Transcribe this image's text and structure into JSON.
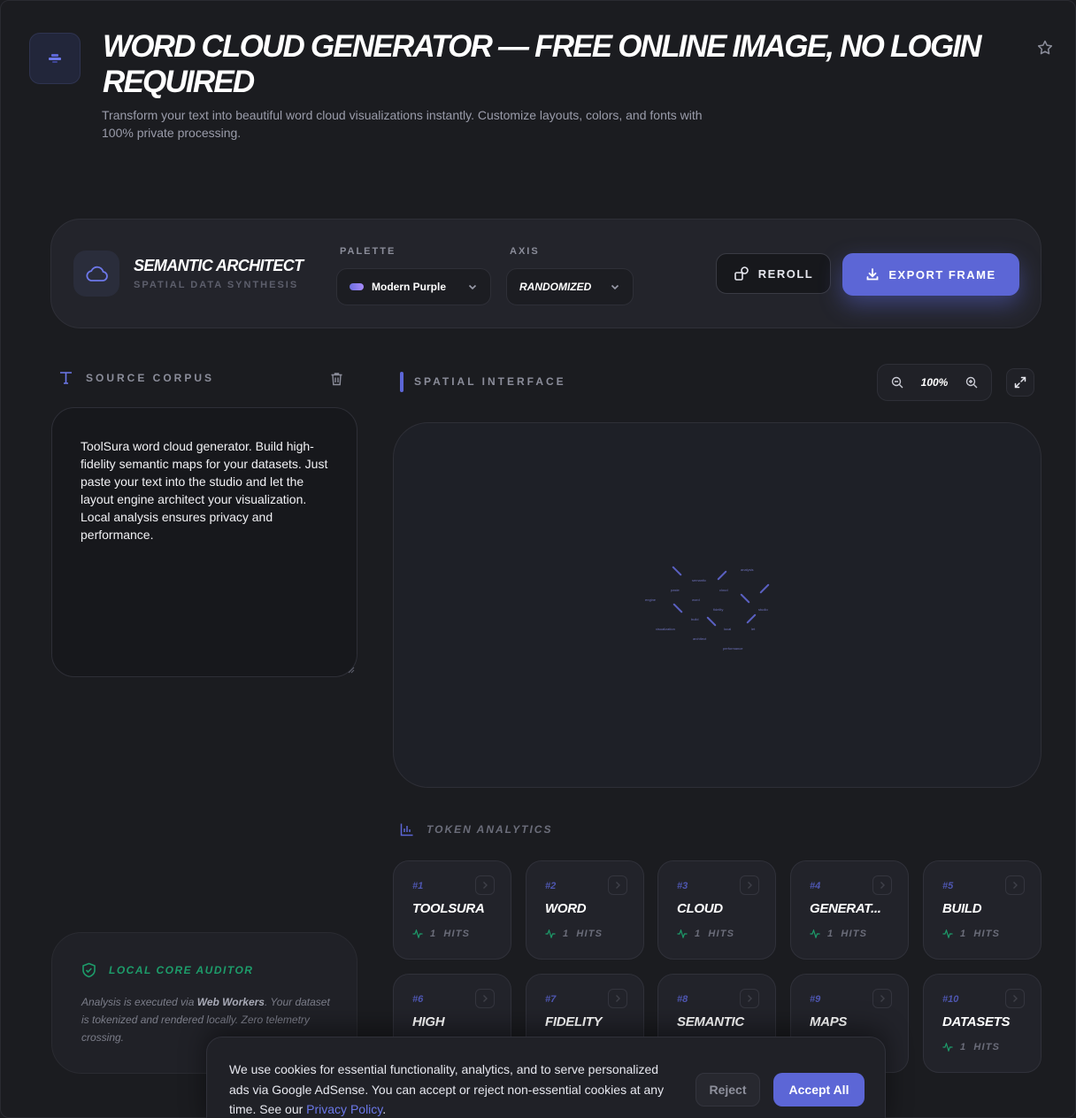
{
  "header": {
    "title": "WORD CLOUD GENERATOR — FREE ONLINE IMAGE, NO LOGIN REQUIRED",
    "subtitle": "Transform your text into beautiful word cloud visualizations instantly. Customize layouts, colors, and fonts with 100% private processing.",
    "logo_icon": "app-logo-icon",
    "favorite_icon": "star-icon"
  },
  "toolbar": {
    "brand_title": "SEMANTIC ARCHITECT",
    "brand_subtitle": "SPATIAL DATA SYNTHESIS",
    "brand_icon": "cloud-icon",
    "palette_label": "PALETTE",
    "palette_value": "Modern Purple",
    "axis_label": "AXIS",
    "axis_value": "RANDOMIZED",
    "reroll_label": "REROLL",
    "export_label": "EXPORT FRAME",
    "accent_color": "#5c66d6"
  },
  "source": {
    "label": "SOURCE CORPUS",
    "text": "ToolSura word cloud generator. Build high-fidelity semantic maps for your datasets. Just paste your text into the studio and let the layout engine architect your visualization. Local analysis ensures privacy and performance."
  },
  "auditor": {
    "title": "LOCAL CORE AUDITOR",
    "text_1": "Analysis is executed via ",
    "text_bold": "Web Workers",
    "text_2": ". Your dataset is tokenized and rendered locally. Zero telemetry crossing."
  },
  "spatial": {
    "label": "SPATIAL INTERFACE",
    "zoom": "100%",
    "cloud_words": [
      "semantic",
      "analysis",
      "paste",
      "cloud",
      "engine",
      "word",
      "fidelity",
      "studio",
      "build",
      "visualization",
      "local",
      "let",
      "architect",
      "performance"
    ]
  },
  "analytics": {
    "label": "TOKEN ANALYTICS",
    "hits_suffix": "HITS",
    "tokens": [
      {
        "rank": "#1",
        "word": "TOOLSURA",
        "hits": "1"
      },
      {
        "rank": "#2",
        "word": "WORD",
        "hits": "1"
      },
      {
        "rank": "#3",
        "word": "CLOUD",
        "hits": "1"
      },
      {
        "rank": "#4",
        "word": "GENERAT...",
        "hits": "1"
      },
      {
        "rank": "#5",
        "word": "BUILD",
        "hits": "1"
      },
      {
        "rank": "#6",
        "word": "HIGH",
        "hits": ""
      },
      {
        "rank": "#7",
        "word": "FIDELITY",
        "hits": ""
      },
      {
        "rank": "#8",
        "word": "SEMANTIC",
        "hits": ""
      },
      {
        "rank": "#9",
        "word": "MAPS",
        "hits": ""
      },
      {
        "rank": "#10",
        "word": "DATASETS",
        "hits": "1"
      }
    ]
  },
  "cookie": {
    "text": "We use cookies for essential functionality, analytics, and to serve personalized ads via Google AdSense. You can accept or reject non-essential cookies at any time. See our ",
    "link": "Privacy Policy",
    "end": ".",
    "reject_label": "Reject",
    "accept_label": "Accept All"
  }
}
